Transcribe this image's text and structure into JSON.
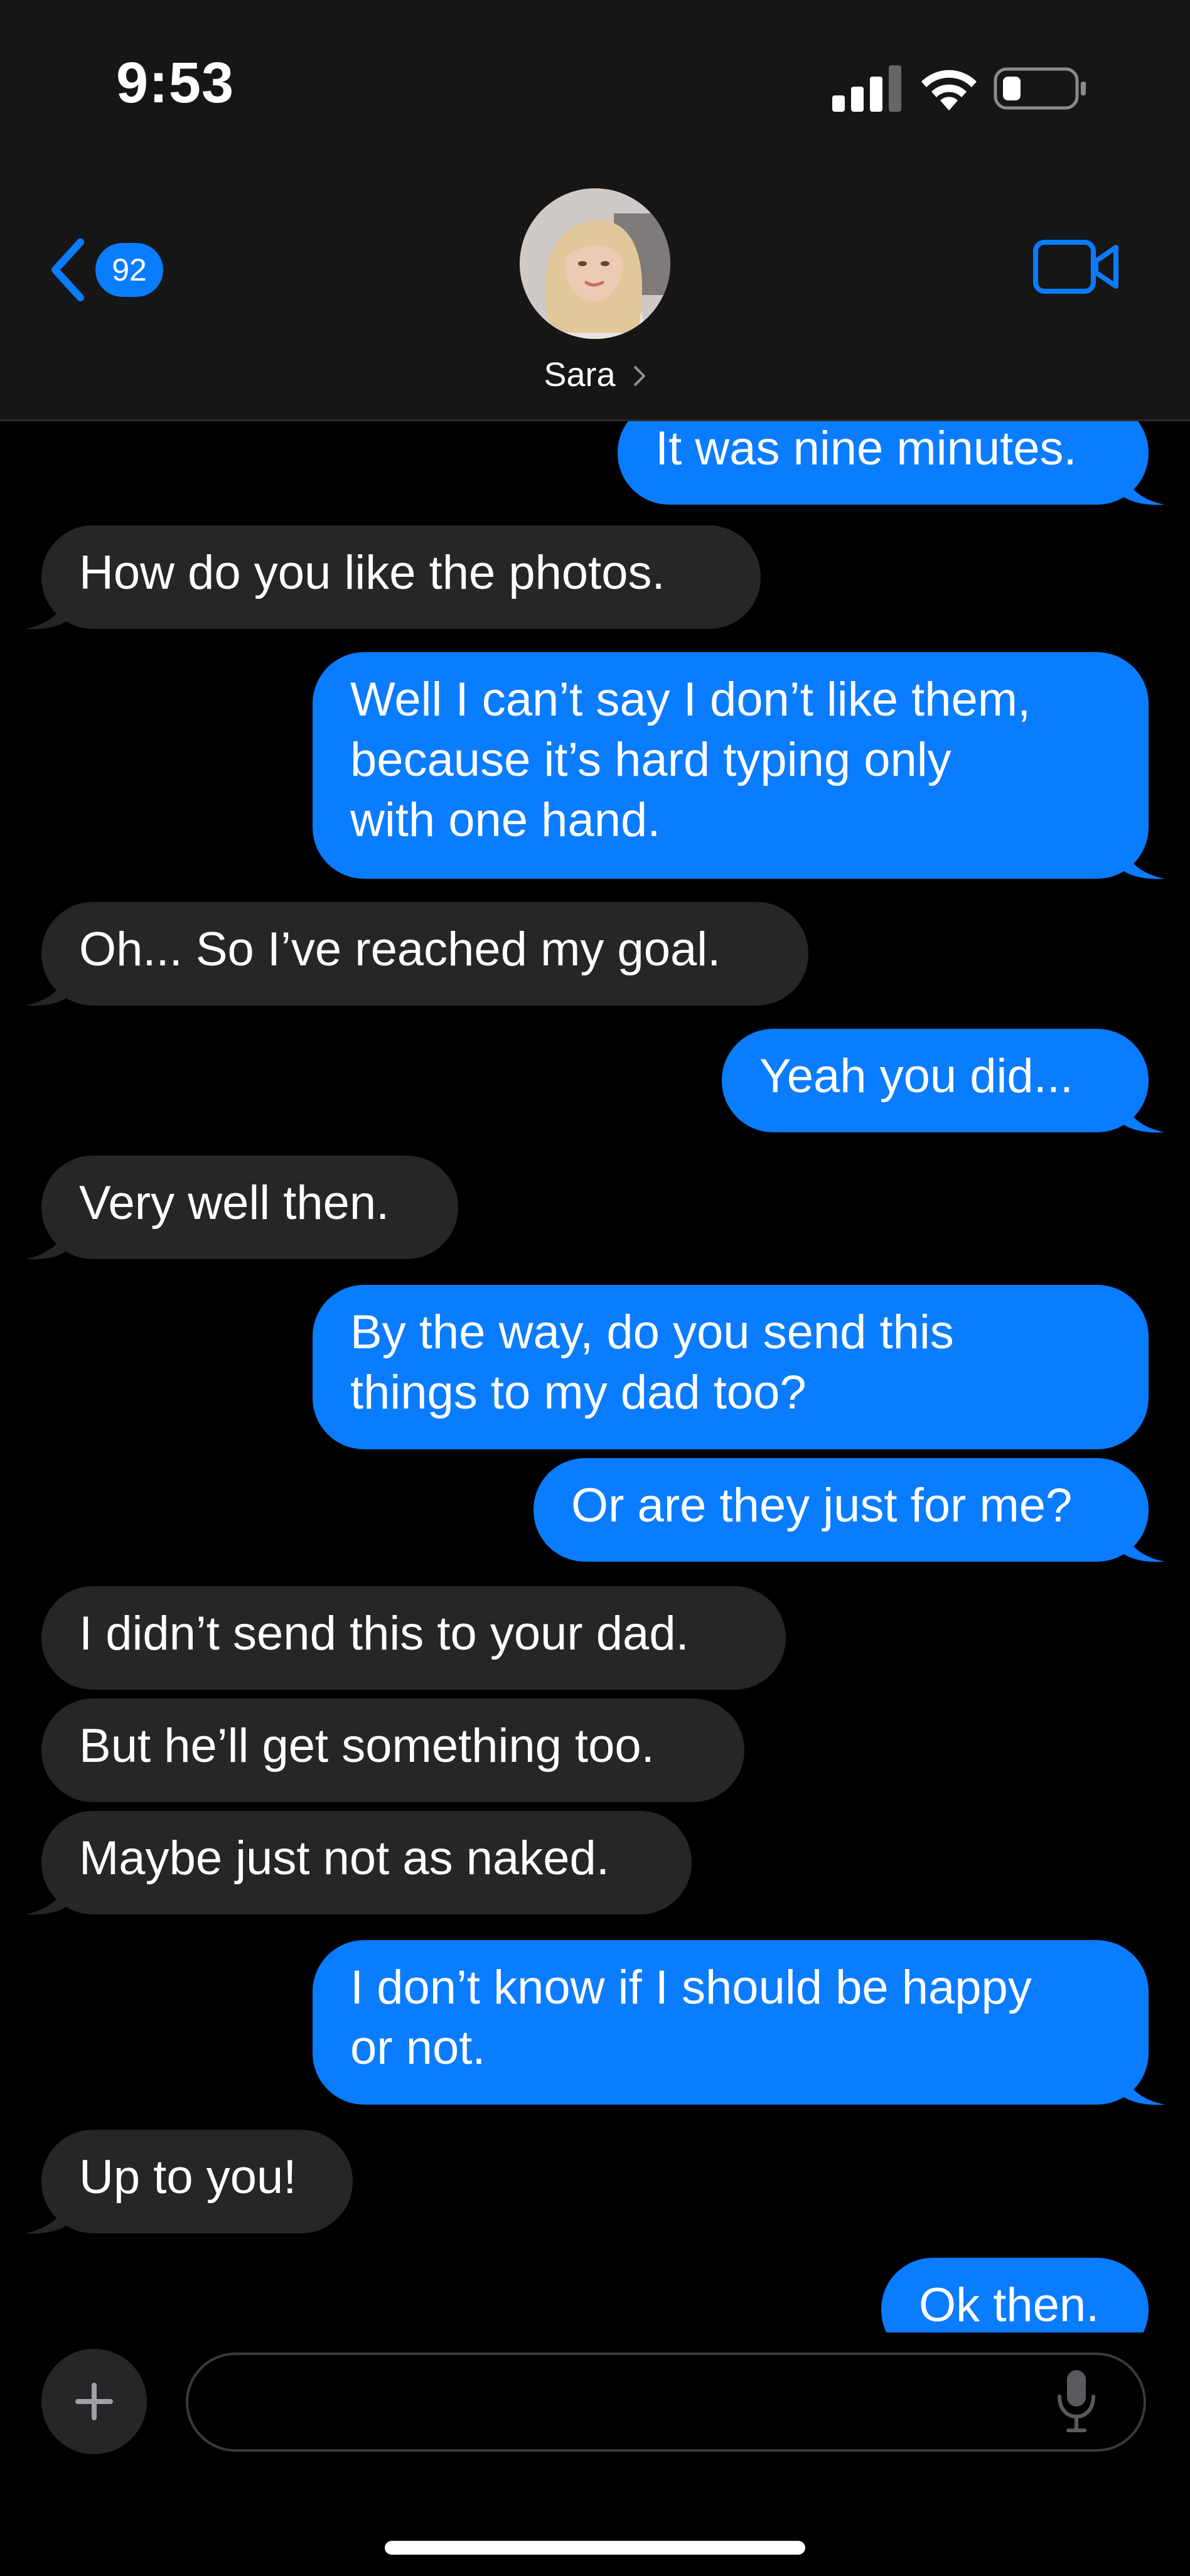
{
  "status_bar": {
    "time": "9:53"
  },
  "header": {
    "unread_count": "92",
    "contact_name": "Sara"
  },
  "colors": {
    "accent": "#0a7cff",
    "incoming_bubble": "#262628",
    "background": "#000000"
  },
  "messages": [
    {
      "from": "me",
      "text": "It was nine minutes."
    },
    {
      "from": "them",
      "text": "How do you like the photos."
    },
    {
      "from": "me",
      "text": "Well I can’t say I don’t like them,\nbecause it’s hard typing only\nwith one hand."
    },
    {
      "from": "them",
      "text": "Oh... So I’ve reached my goal."
    },
    {
      "from": "me",
      "text": "Yeah you did..."
    },
    {
      "from": "them",
      "text": "Very well then."
    },
    {
      "from": "me",
      "text": "By the way, do you send this\nthings to my dad too?"
    },
    {
      "from": "me",
      "text": "Or are they just for me?"
    },
    {
      "from": "them",
      "text": "I didn’t send this to your dad."
    },
    {
      "from": "them",
      "text": "But he’ll get something too."
    },
    {
      "from": "them",
      "text": "Maybe just not as naked."
    },
    {
      "from": "me",
      "text": "I don’t know if I should be happy\nor not."
    },
    {
      "from": "them",
      "text": "Up to you!"
    },
    {
      "from": "me",
      "text": "Ok then."
    }
  ],
  "composer": {
    "placeholder": ""
  }
}
